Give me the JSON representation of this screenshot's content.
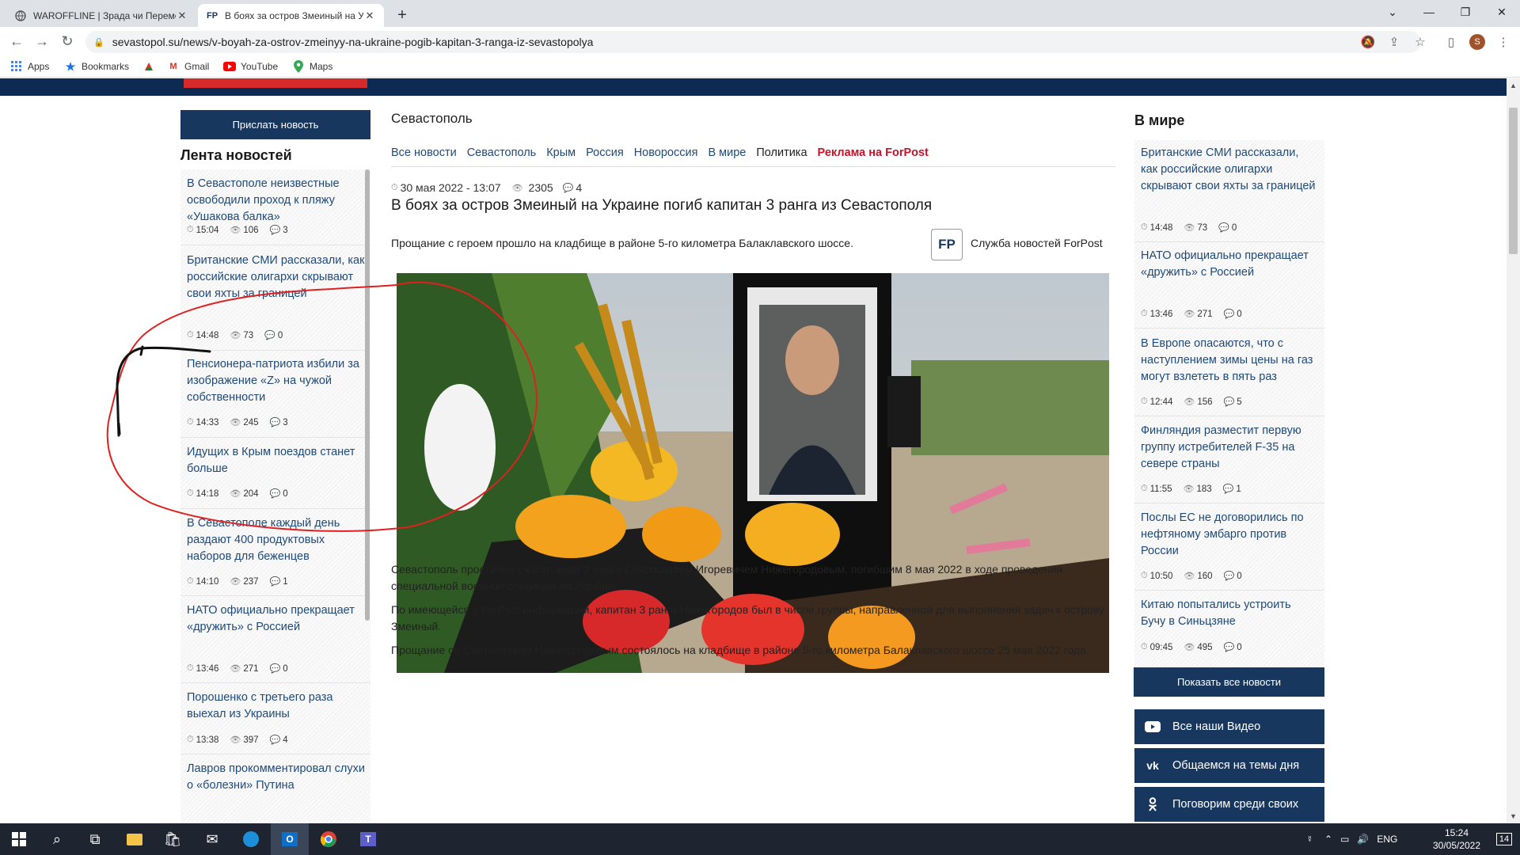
{
  "browser": {
    "tabs": [
      {
        "title": "WAROFFLINE | Зрада чи Перемо",
        "favicon": "globe-icon",
        "active": false
      },
      {
        "title": "В боях за остров Змеиный на У",
        "favicon": "FP",
        "active": true
      }
    ],
    "url": "sevastopol.su/news/v-boyah-za-ostrov-zmeinyy-na-ukraine-pogib-kapitan-3-ranga-iz-sevastopolya",
    "bookmarks": [
      {
        "label": "Apps",
        "icon": "apps-grid-icon"
      },
      {
        "label": "Bookmarks",
        "icon": "star-icon"
      },
      {
        "label": "",
        "icon": "site-icon"
      },
      {
        "label": "Gmail",
        "icon": "gmail-icon"
      },
      {
        "label": "YouTube",
        "icon": "youtube-icon"
      },
      {
        "label": "Maps",
        "icon": "maps-pin-icon"
      }
    ],
    "avatar_letter": "S"
  },
  "left": {
    "submit_button": "Прислать новость",
    "feed_title": "Лента новостей",
    "items": [
      {
        "title": "В Севастополе неизвестные освободили проход к пляжу «Ушакова балка»",
        "time": "15:04",
        "views": "106",
        "comments": "3"
      },
      {
        "title": "Британские СМИ рассказали, как российские олигархи скрывают свои яхты за границей",
        "time": "14:48",
        "views": "73",
        "comments": "0"
      },
      {
        "title": "Пенсионера-патриота избили за изображение «Z» на чужой собственности",
        "time": "14:33",
        "views": "245",
        "comments": "3"
      },
      {
        "title": "Идущих в Крым поездов станет больше",
        "time": "14:18",
        "views": "204",
        "comments": "0"
      },
      {
        "title": "В Севастополе каждый день раздают 400 продуктовых наборов для беженцев",
        "time": "14:10",
        "views": "237",
        "comments": "1"
      },
      {
        "title": "НАТО официально прекращает «дружить» с Россией",
        "time": "13:46",
        "views": "271",
        "comments": "0"
      },
      {
        "title": "Порошенко с третьего раза выехал из Украины",
        "time": "13:38",
        "views": "397",
        "comments": "4"
      },
      {
        "title": "Лавров прокомментировал слухи о «болезни» Путина",
        "time": "",
        "views": "",
        "comments": ""
      }
    ]
  },
  "center": {
    "breadcrumb": "Севастополь",
    "nav": [
      {
        "label": "Все новости",
        "accent": false
      },
      {
        "label": "Севастополь",
        "accent": false
      },
      {
        "label": "Крым",
        "accent": false
      },
      {
        "label": "Россия",
        "accent": false
      },
      {
        "label": "Новороссия",
        "accent": false
      },
      {
        "label": "В мире",
        "accent": false
      },
      {
        "label": "Политика",
        "accent": false
      },
      {
        "label": "Реклама на ForPost",
        "accent": true
      }
    ],
    "date": "30 мая 2022 - 13:07",
    "views": "2305",
    "comments": "4",
    "title": "В боях за остров Змеиный на Украине погиб капитан 3 ранга из Севастополя",
    "lead": "Прощание с героем прошло на кладбище в районе 5-го километра Балаклавского шоссе.",
    "source_logo": "FP",
    "source": "Служба новостей ForPost",
    "paragraphs": [
      "Севастополь простился с капитаном 3 ранга Святославом Игоревичем Нижегородовым, погибшим 8 мая 2022 в ходе проведения специальной военной операции на Украине.",
      "По имеющейся у ForPost информации, капитан 3 ранга Нижегородов был в числе группы, направленной для выполнения задач к острову Змеиный.",
      "Прощание со Святославом Нижегородовым состоялось на кладбище в районе 5-го километра Балаклавского шоссе 25 мая 2022 года."
    ]
  },
  "right": {
    "title": "В мире",
    "items": [
      {
        "title": "Британские СМИ рассказали, как российские олигархи скрывают свои яхты за границей",
        "time": "14:48",
        "views": "73",
        "comments": "0"
      },
      {
        "title": "НАТО официально прекращает «дружить» с Россией",
        "time": "13:46",
        "views": "271",
        "comments": "0"
      },
      {
        "title": "В Европе опасаются, что с наступлением зимы цены на газ могут взлететь в пять раз",
        "time": "12:44",
        "views": "156",
        "comments": "5"
      },
      {
        "title": "Финляндия разместит первую группу истребителей F-35 на севере страны",
        "time": "11:55",
        "views": "183",
        "comments": "1"
      },
      {
        "title": "Послы ЕС не договорились по нефтяному эмбарго против России",
        "time": "10:50",
        "views": "160",
        "comments": "0"
      },
      {
        "title": "Китаю попытались устроить Бучу в Синьцзяне",
        "time": "09:45",
        "views": "495",
        "comments": "0"
      }
    ],
    "show_all": "Показать все новости",
    "social": [
      {
        "label": "Все наши Видео",
        "icon": "youtube-icon"
      },
      {
        "label": "Общаемся на темы дня",
        "icon": "vk-icon"
      },
      {
        "label": "Поговорим среди своих",
        "icon": "odnoklassniki-icon"
      }
    ]
  },
  "taskbar": {
    "lang": "ENG",
    "time": "15:24",
    "date": "30/05/2022",
    "notifications": "14"
  },
  "colors": {
    "navy": "#18375e",
    "accent_red": "#c0152b",
    "annotation": "#e02020"
  }
}
